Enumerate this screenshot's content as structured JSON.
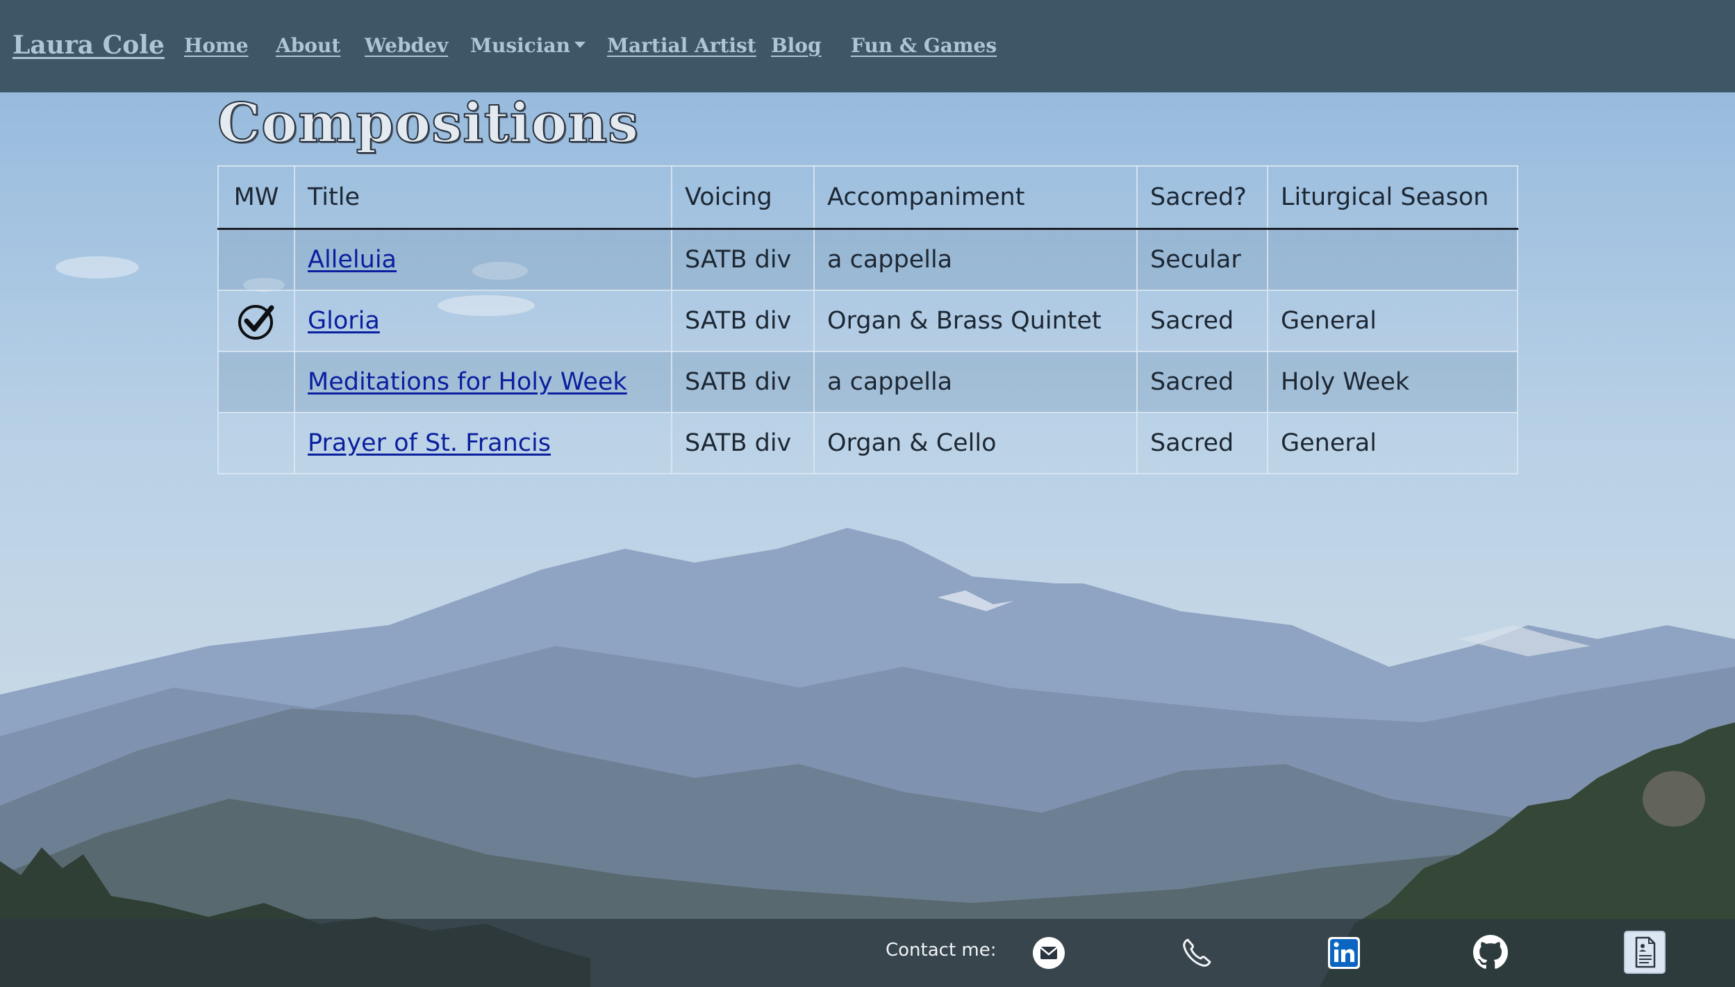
{
  "navbar": {
    "brand": "Laura Cole",
    "links": [
      {
        "label": "Home"
      },
      {
        "label": "About"
      },
      {
        "label": "Webdev"
      },
      {
        "label": "Musician",
        "dropdown": true
      },
      {
        "label": "Martial Artist"
      },
      {
        "label": "Blog"
      },
      {
        "label": "Fun & Games"
      }
    ]
  },
  "page": {
    "title": "Compositions"
  },
  "table": {
    "headers": [
      "MW",
      "Title",
      "Voicing",
      "Accompaniment",
      "Sacred?",
      "Liturgical Season"
    ],
    "rows": [
      {
        "mw": false,
        "title": "Alleluia",
        "voicing": "SATB div",
        "accompaniment": "a cappella",
        "sacred": "Secular",
        "season": ""
      },
      {
        "mw": true,
        "mw_icon": "check-circle-icon",
        "title": "Gloria",
        "voicing": "SATB div",
        "accompaniment": "Organ & Brass Quintet",
        "sacred": "Sacred",
        "season": "General"
      },
      {
        "mw": false,
        "title": "Meditations for Holy Week",
        "voicing": "SATB div",
        "accompaniment": "a cappella",
        "sacred": "Sacred",
        "season": "Holy Week"
      },
      {
        "mw": false,
        "title": "Prayer of St. Francis",
        "voicing": "SATB div",
        "accompaniment": "Organ & Cello",
        "sacred": "Sacred",
        "season": "General"
      }
    ]
  },
  "footer": {
    "contact_label": "Contact me:",
    "icons": [
      "email-icon",
      "phone-icon",
      "linkedin-icon",
      "github-icon",
      "resume-icon"
    ]
  },
  "colors": {
    "navbar_bg": "#3e5766",
    "nav_text": "#aec5d8",
    "link": "#0a1f9e",
    "footer_bg": "#2d373e",
    "linkedin": "#0a66c2"
  }
}
